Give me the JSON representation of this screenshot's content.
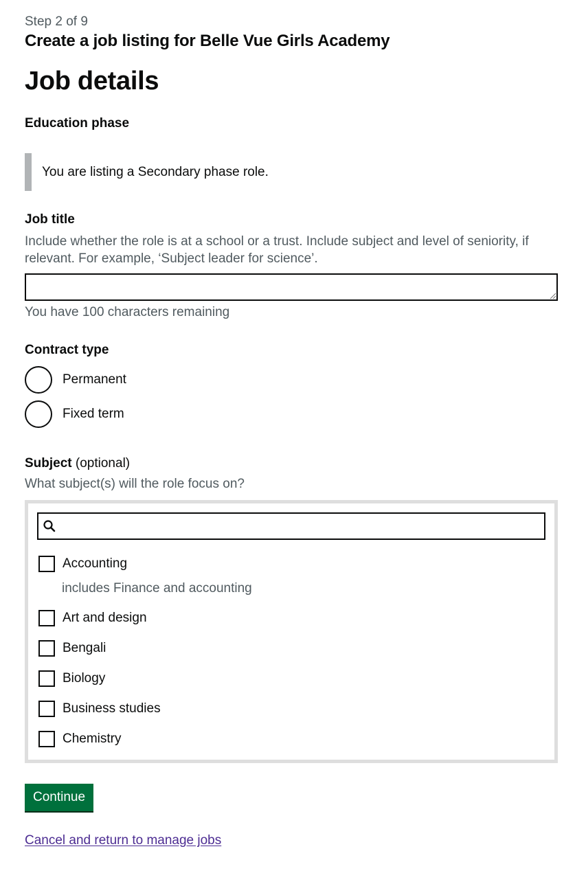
{
  "header": {
    "step": "Step 2 of 9",
    "caption": "Create a job listing for Belle Vue Girls Academy"
  },
  "page_title": "Job details",
  "education_phase": {
    "label": "Education phase",
    "inset_text": "You are listing a Secondary phase role."
  },
  "job_title": {
    "label": "Job title",
    "hint": "Include whether the role is at a school or a trust. Include subject and level of seniority, if relevant. For example, ‘Subject leader for science’.",
    "value": "",
    "character_count": "You have 100 characters remaining"
  },
  "contract_type": {
    "label": "Contract type",
    "options": [
      {
        "label": "Permanent",
        "checked": false
      },
      {
        "label": "Fixed term",
        "checked": false
      }
    ]
  },
  "subject": {
    "label": "Subject",
    "optional_suffix": "(optional)",
    "hint": "What subject(s) will the role focus on?",
    "search_value": "",
    "options": [
      {
        "label": "Accounting",
        "hint": "includes Finance and accounting",
        "checked": false
      },
      {
        "label": "Art and design",
        "checked": false
      },
      {
        "label": "Bengali",
        "checked": false
      },
      {
        "label": "Biology",
        "checked": false
      },
      {
        "label": "Business studies",
        "checked": false
      },
      {
        "label": "Chemistry",
        "checked": false
      }
    ]
  },
  "actions": {
    "continue_label": "Continue",
    "cancel_label": "Cancel and return to manage jobs"
  },
  "colors": {
    "text": "#0b0c0c",
    "secondary_text": "#505a5f",
    "button_green": "#00703c",
    "link_purple": "#4c2c92",
    "inset_border": "#b1b4b6",
    "panel_border": "#dedede"
  },
  "icons": {
    "search": "search-icon",
    "resize": "resize-handle-icon"
  }
}
